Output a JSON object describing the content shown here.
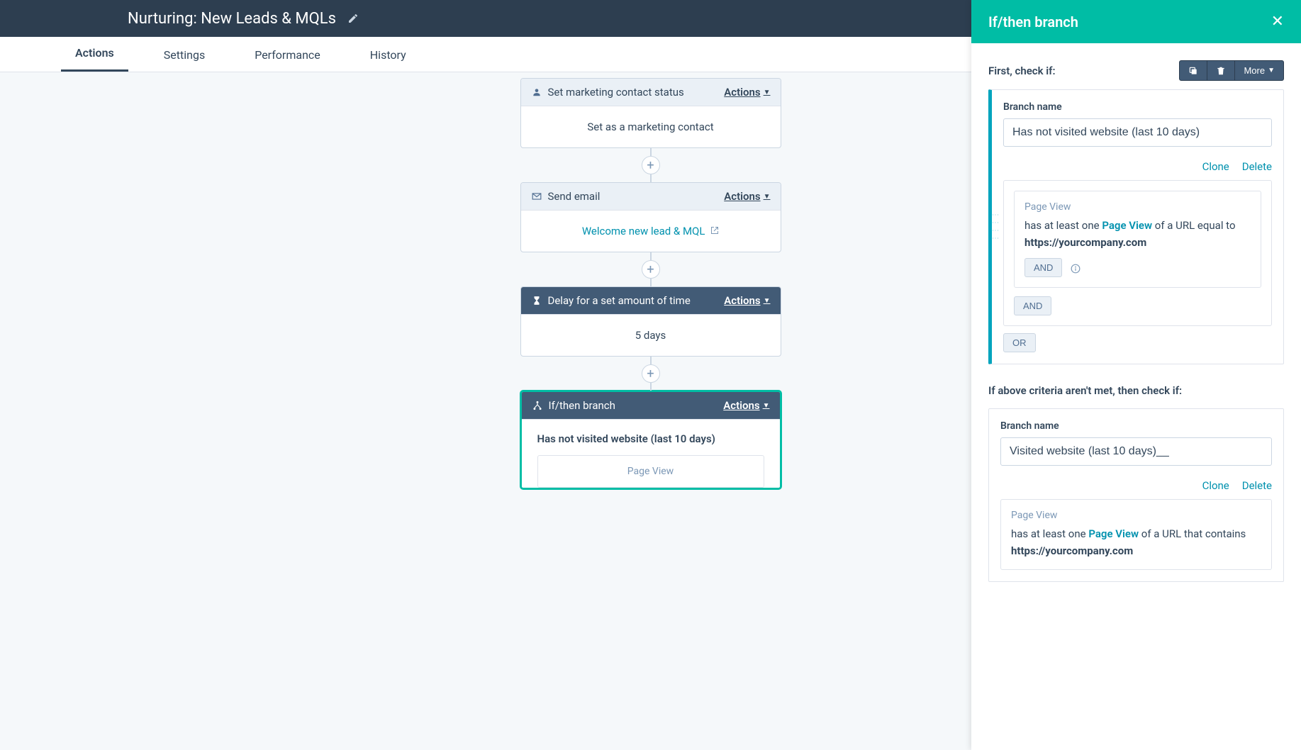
{
  "header": {
    "title": "Nurturing: New Leads & MQLs"
  },
  "tabs": {
    "actions": "Actions",
    "settings": "Settings",
    "performance": "Performance",
    "history": "History"
  },
  "cards": {
    "status": {
      "title": "Set marketing contact status",
      "actions": "Actions",
      "body": "Set as a marketing contact"
    },
    "email": {
      "title": "Send email",
      "actions": "Actions",
      "link": "Welcome new lead & MQL"
    },
    "delay": {
      "title": "Delay for a set amount of time",
      "actions": "Actions",
      "body": "5 days"
    },
    "branch": {
      "title": "If/then branch",
      "actions": "Actions",
      "branch1": "Has not visited website (last 10 days)",
      "ruleTitle": "Page View"
    }
  },
  "panel": {
    "title": "If/then branch",
    "firstLabel": "First, check if:",
    "more": "More",
    "branchNameLabel": "Branch name",
    "branch1": {
      "name": "Has not visited website (last 10 days)",
      "clone": "Clone",
      "delete": "Delete",
      "criteriaTitle": "Page View",
      "criteriaPre": "has at least one ",
      "criteriaHl": "Page View",
      "criteriaMid": " of a URL equal to ",
      "criteriaUrl": "https://yourcompany.com",
      "and": "AND",
      "and2": "AND",
      "or": "OR"
    },
    "elseLabel": "If above criteria aren't met, then check if:",
    "branch2": {
      "name": "Visited website (last 10 days)__",
      "clone": "Clone",
      "delete": "Delete",
      "criteriaTitle": "Page View",
      "criteriaPre": "has at least one ",
      "criteriaHl": "Page View",
      "criteriaMid": " of a URL that contains ",
      "criteriaUrl": "https://yourcompany.com"
    }
  }
}
